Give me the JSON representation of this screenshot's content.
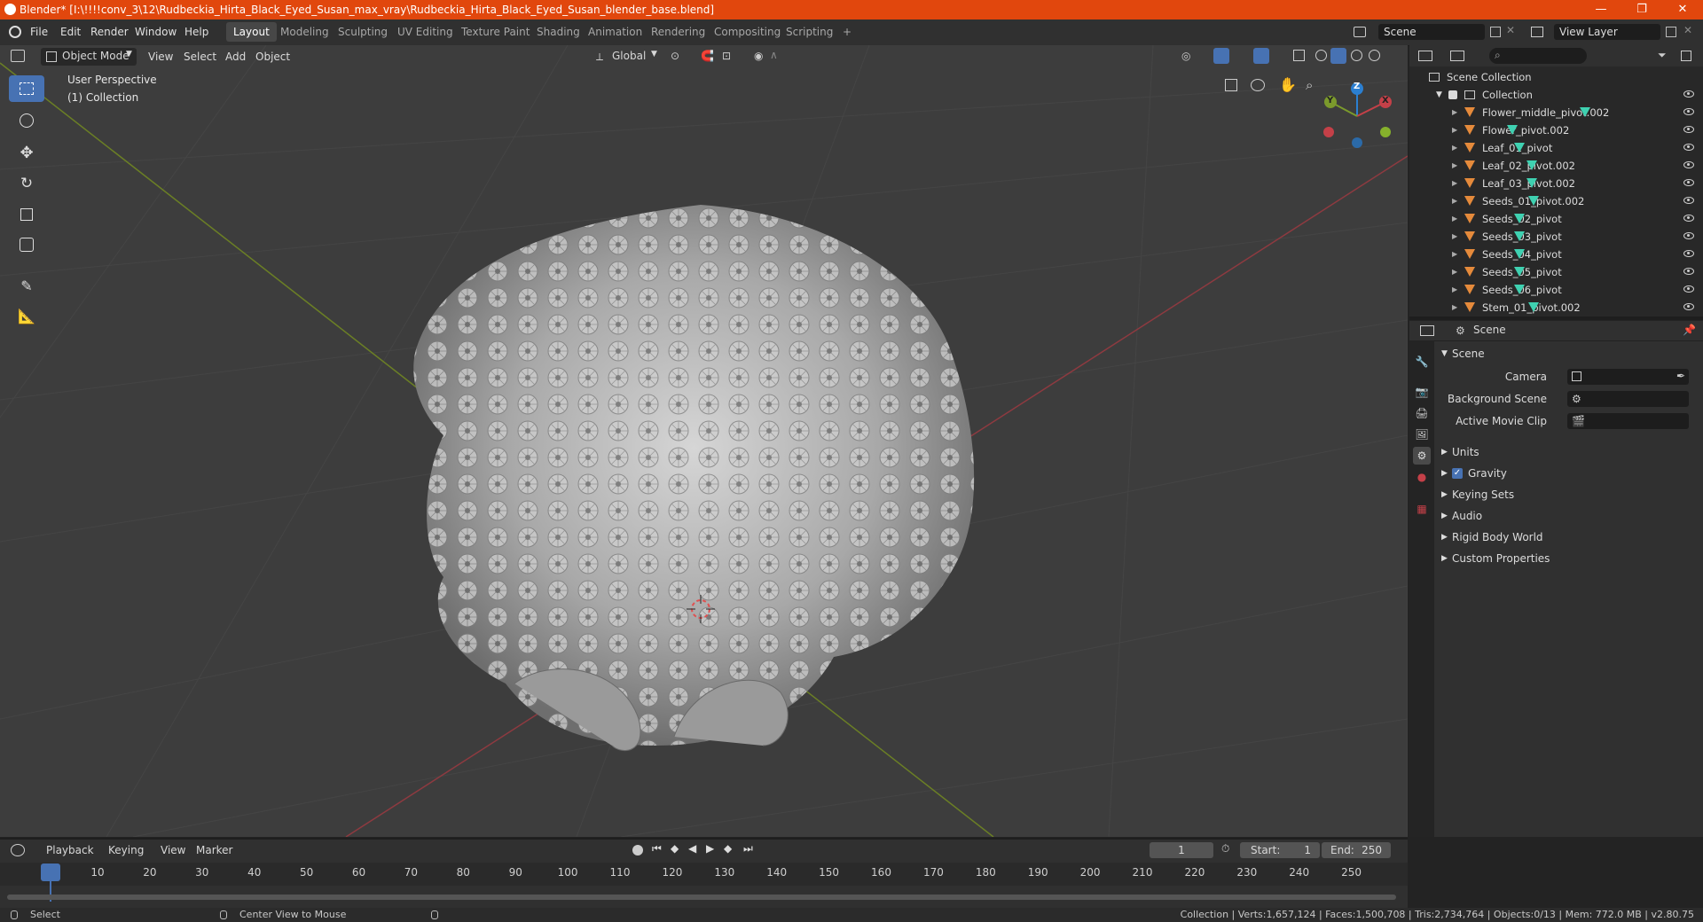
{
  "titlebar": {
    "title": "Blender* [I:\\!!!!conv_3\\12\\Rudbeckia_Hirta_Black_Eyed_Susan_max_vray\\Rudbeckia_Hirta_Black_Eyed_Susan_blender_base.blend]",
    "min": "—",
    "max": "❐",
    "close": "✕"
  },
  "menu": [
    "File",
    "Edit",
    "Render",
    "Window",
    "Help"
  ],
  "workspaces": [
    "Layout",
    "Modeling",
    "Sculpting",
    "UV Editing",
    "Texture Paint",
    "Shading",
    "Animation",
    "Rendering",
    "Compositing",
    "Scripting"
  ],
  "workspace_add": "+",
  "scene_field": "Scene",
  "viewlayer_field": "View Layer",
  "viewport": {
    "mode": "Object Mode",
    "menus": [
      "View",
      "Select",
      "Add",
      "Object"
    ],
    "orientation": "Global",
    "overlay_line1": "User Perspective",
    "overlay_line2": "(1) Collection",
    "gizmo": {
      "x": "X",
      "y": "Y",
      "z": "Z"
    }
  },
  "outliner": {
    "root": "Scene Collection",
    "collection": "Collection",
    "items": [
      "Flower_middle_pivot.002",
      "Flower_pivot.002",
      "Leaf_01_pivot",
      "Leaf_02_pivot.002",
      "Leaf_03_pivot.002",
      "Seeds_01_pivot.002",
      "Seeds_02_pivot",
      "Seeds_03_pivot",
      "Seeds_04_pivot",
      "Seeds_05_pivot",
      "Seeds_06_pivot",
      "Stem_01_pivot.002"
    ]
  },
  "properties": {
    "context": "Scene",
    "panel": "Scene",
    "camera_label": "Camera",
    "bg_scene_label": "Background Scene",
    "movie_clip_label": "Active Movie Clip",
    "sections": [
      "Units",
      "Gravity",
      "Keying Sets",
      "Audio",
      "Rigid Body World",
      "Custom Properties"
    ]
  },
  "timeline": {
    "menus": [
      "Playback",
      "Keying",
      "View",
      "Marker"
    ],
    "current_frame": "1",
    "start_label": "Start:",
    "start": "1",
    "end_label": "End:",
    "end": "250",
    "ticks": [
      "1",
      "10",
      "20",
      "30",
      "40",
      "50",
      "60",
      "70",
      "80",
      "90",
      "100",
      "110",
      "120",
      "130",
      "140",
      "150",
      "160",
      "170",
      "180",
      "190",
      "200",
      "210",
      "220",
      "230",
      "240",
      "250"
    ]
  },
  "statusbar": {
    "select": "Select",
    "center": "Center View to Mouse",
    "stats": "Collection | Verts:1,657,124 | Faces:1,500,708 | Tris:2,734,764 | Objects:0/13 | Mem: 772.0 MB | v2.80.75"
  },
  "colors": {
    "titlebar": "#e1470d",
    "accent": "#4772b3",
    "x_axis": "#c44048",
    "y_axis": "#7b9a2c",
    "z_axis": "#2b7fd1",
    "mesh_icon": "#3fd1b1",
    "object_icon": "#e58a3b"
  }
}
